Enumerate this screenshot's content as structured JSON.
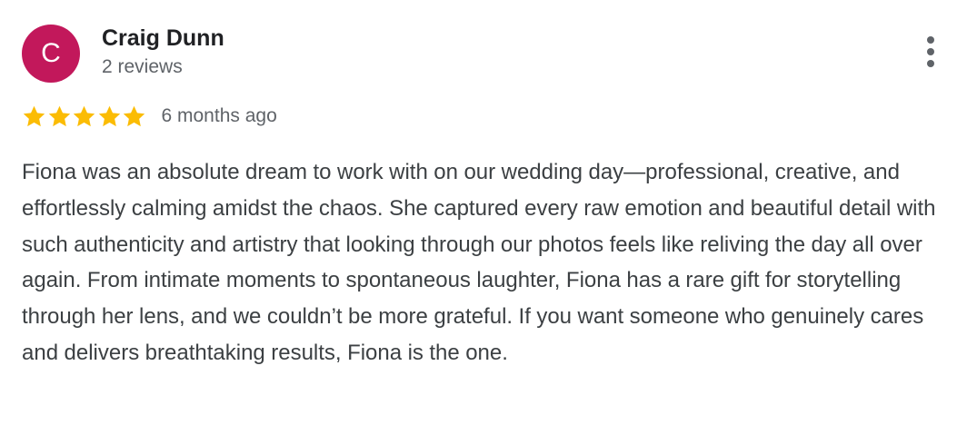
{
  "review": {
    "author": {
      "initial": "C",
      "name": "Craig Dunn",
      "reviews_count": "2 reviews",
      "avatar_color": "#c2185b"
    },
    "rating": 5,
    "max_rating": 5,
    "star_color": "#fbbc04",
    "date": "6 months ago",
    "text": "Fiona was an absolute dream to work with on our wedding day—professional, creative, and effortlessly calming amidst the chaos. She captured every raw emotion and beautiful detail with such authenticity and artistry that looking through our photos feels like reliving the day all over again. From intimate moments to spontaneous laughter, Fiona has a rare gift for storytelling through her lens, and we couldn’t be more grateful. If you want someone who genuinely cares and delivers breathtaking results, Fiona is the one.",
    "menu_icon": "more-vert-icon"
  }
}
